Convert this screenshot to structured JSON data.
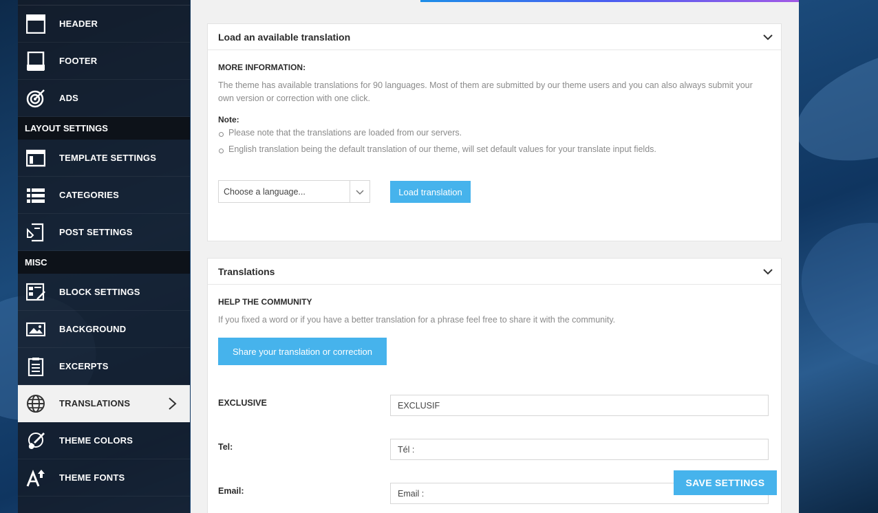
{
  "sidebar": {
    "items_top": [
      {
        "label": "HEADER",
        "icon": "header-icon"
      },
      {
        "label": "FOOTER",
        "icon": "footer-icon"
      },
      {
        "label": "ADS",
        "icon": "target-icon"
      }
    ],
    "section_layout": "LAYOUT SETTINGS",
    "items_layout": [
      {
        "label": "TEMPLATE SETTINGS",
        "icon": "template-icon"
      },
      {
        "label": "CATEGORIES",
        "icon": "list-icon"
      },
      {
        "label": "POST SETTINGS",
        "icon": "post-icon"
      }
    ],
    "section_misc": "MISC",
    "items_misc": [
      {
        "label": "BLOCK SETTINGS",
        "icon": "block-icon"
      },
      {
        "label": "BACKGROUND",
        "icon": "image-icon"
      },
      {
        "label": "EXCERPTS",
        "icon": "clipboard-icon"
      },
      {
        "label": "TRANSLATIONS",
        "icon": "globe-icon",
        "active": true
      },
      {
        "label": "THEME COLORS",
        "icon": "brush-icon"
      },
      {
        "label": "THEME FONTS",
        "icon": "font-icon"
      }
    ]
  },
  "load_card": {
    "title": "Load an available translation",
    "more_info_title": "MORE INFORMATION:",
    "more_info_text": "The theme has available translations for 90 languages. Most of them are submitted by our theme users and you can also always submit your own version or correction with one click.",
    "note_title": "Note:",
    "notes": [
      "Please note that the translations are loaded from our servers.",
      "English translation being the default translation of our theme, will set default values for your translate input fields."
    ],
    "select_placeholder": "Choose a language...",
    "load_button": "Load translation"
  },
  "translations_card": {
    "title": "Translations",
    "help_title": "HELP THE COMMUNITY",
    "help_text": "If you fixed a word or if you have a better translation for a phrase feel free to share it with the community.",
    "share_button": "Share your translation or correction",
    "fields": [
      {
        "label": "EXCLUSIVE",
        "value": "EXCLUSIF"
      },
      {
        "label": "Tel:",
        "value": "Tél :"
      },
      {
        "label": "Email:",
        "value": "Email :"
      }
    ]
  },
  "save_button": "SAVE SETTINGS",
  "colors": {
    "accent": "#46b3ec",
    "sidebar": "#141a24",
    "panel": "#f1f1f1"
  }
}
